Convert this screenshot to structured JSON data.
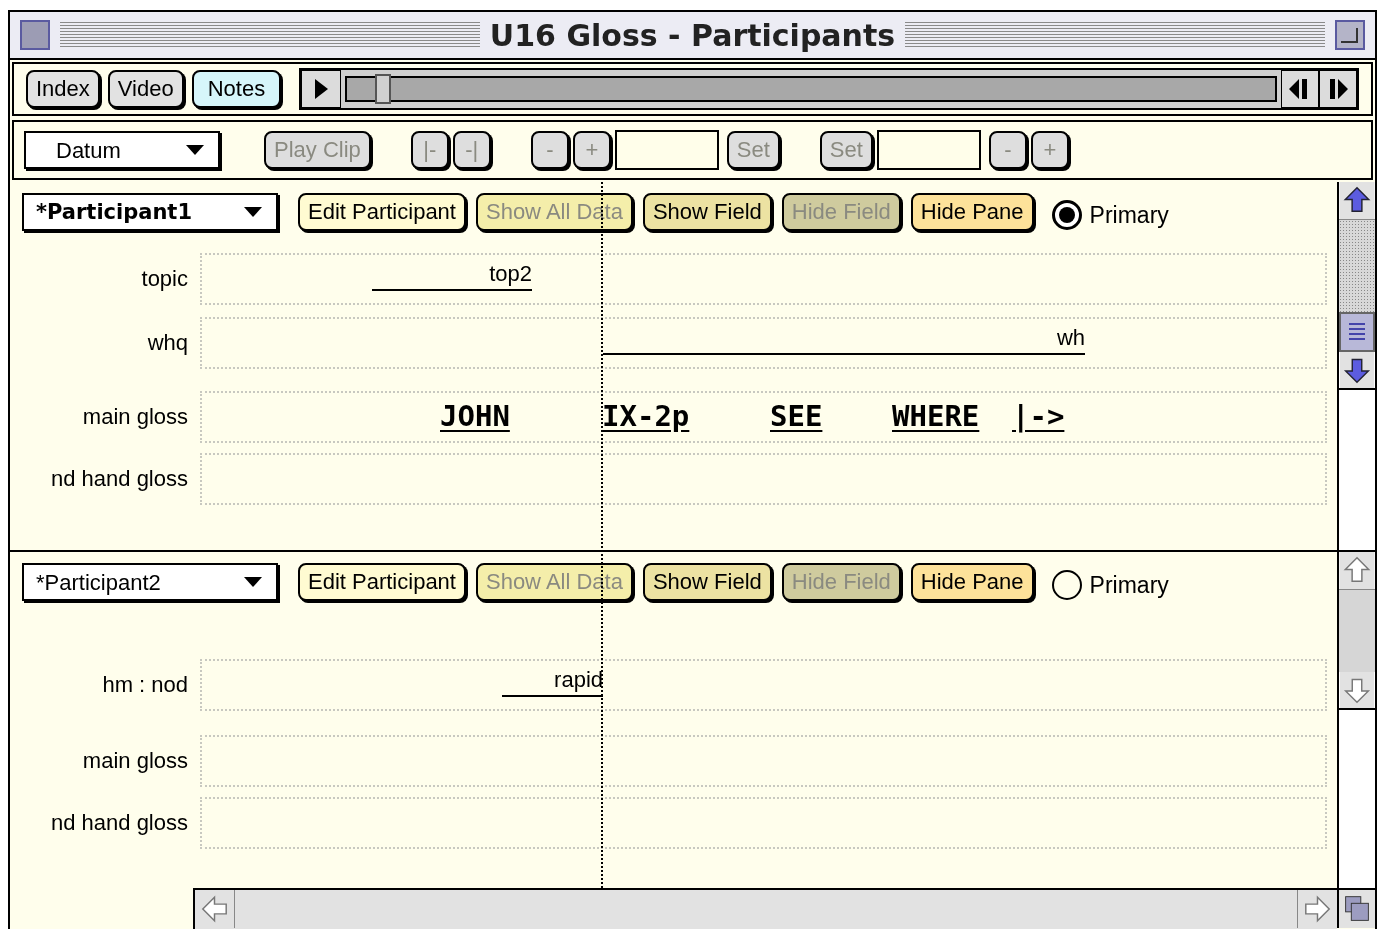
{
  "window": {
    "title": "U16 Gloss - Participants"
  },
  "nav_buttons": [
    {
      "label": "Index",
      "selected": false
    },
    {
      "label": "Video",
      "selected": false
    },
    {
      "label": "Notes",
      "selected": true
    }
  ],
  "transport": {
    "level": 0.03
  },
  "clip_controls": [
    {
      "kind": "dropdown",
      "label": "Datum",
      "disabled": false
    },
    {
      "kind": "button",
      "label": "Play Clip",
      "disabled": true
    },
    {
      "kind": "button",
      "label": "|-",
      "disabled": true
    },
    {
      "kind": "button",
      "label": "-|",
      "disabled": true
    },
    {
      "kind": "button",
      "label": "-",
      "disabled": true
    },
    {
      "kind": "button",
      "label": "+",
      "disabled": true
    },
    {
      "kind": "field"
    },
    {
      "kind": "button",
      "label": "Set",
      "disabled": true
    },
    {
      "kind": "button",
      "label": "Set",
      "disabled": true
    },
    {
      "kind": "field"
    },
    {
      "kind": "button",
      "label": "-",
      "disabled": true
    },
    {
      "kind": "button",
      "label": "+",
      "disabled": true
    }
  ],
  "panes": [
    {
      "participant": "*Participant1",
      "bold": true,
      "buttons": [
        {
          "label": "Edit Participant",
          "disabled": false,
          "color": "#fffbd2"
        },
        {
          "label": "Show All Data",
          "disabled": true,
          "color": "#f4eeaa"
        },
        {
          "label": "Show Field",
          "disabled": false,
          "color": "#ece2a2"
        },
        {
          "label": "Hide Field",
          "disabled": true,
          "color": "#cfcb9e"
        },
        {
          "label": "Hide Pane",
          "disabled": false,
          "color": "#fde29a"
        }
      ],
      "primary": {
        "label": "Primary",
        "selected": true
      },
      "fields": [
        {
          "label": "topic",
          "annotations": [
            {
              "kind": "span",
              "text": "top2"
            }
          ]
        },
        {
          "label": "whq",
          "annotations": [
            {
              "kind": "span",
              "text": "wh"
            }
          ]
        },
        {
          "label": "main gloss",
          "annotations": [
            {
              "kind": "gloss",
              "text": "JOHN"
            },
            {
              "kind": "gloss",
              "text": "IX-2p"
            },
            {
              "kind": "gloss",
              "text": "SEE"
            },
            {
              "kind": "gloss",
              "text": "WHERE"
            },
            {
              "kind": "gloss",
              "text": "|->"
            }
          ]
        },
        {
          "label": "nd hand gloss"
        }
      ]
    },
    {
      "participant": "*Participant2",
      "bold": false,
      "buttons": [
        {
          "label": "Edit Participant",
          "disabled": false,
          "color": "#fffbd2"
        },
        {
          "label": "Show All Data",
          "disabled": true,
          "color": "#f4eeaa"
        },
        {
          "label": "Show Field",
          "disabled": false,
          "color": "#ece2a2"
        },
        {
          "label": "Hide Field",
          "disabled": true,
          "color": "#cfcb9e"
        },
        {
          "label": "Hide Pane",
          "disabled": false,
          "color": "#fde29a"
        }
      ],
      "primary": {
        "label": "Primary",
        "selected": false
      },
      "fields": [
        {
          "label": "hm : nod",
          "annotations": [
            {
              "kind": "span",
              "text": "rapid"
            }
          ]
        },
        {
          "label": "main gloss"
        },
        {
          "label": "nd hand gloss"
        }
      ]
    }
  ]
}
